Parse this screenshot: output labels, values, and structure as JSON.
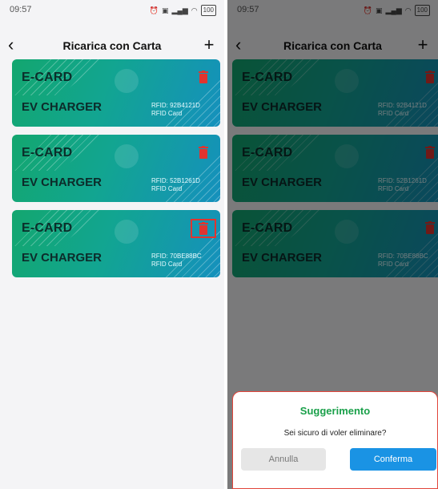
{
  "left_screen": {
    "status": {
      "time": "09:57",
      "icons": [
        "alarm-icon",
        "data-speed-icon",
        "sim-icon",
        "4g-signal-icon",
        "wifi-icon"
      ],
      "battery": "100"
    },
    "nav": {
      "title": "Ricarica con Carta",
      "back_icon": "chevron-left-icon",
      "add_icon": "plus-icon"
    },
    "cards": [
      {
        "brand": "E-CARD",
        "title": "EV CHARGER",
        "rfid": "RFID: 92B4121D",
        "type": "RFID Card"
      },
      {
        "brand": "E-CARD",
        "title": "EV CHARGER",
        "rfid": "RFID: 52B1261D",
        "type": "RFID Card"
      },
      {
        "brand": "E-CARD",
        "title": "EV CHARGER",
        "rfid": "RFID: 70BE88BC",
        "type": "RFID Card"
      }
    ]
  },
  "right_screen": {
    "status": {
      "time": "09:57",
      "battery": "100"
    },
    "nav": {
      "title": "Ricarica con Carta"
    },
    "cards": [
      {
        "brand": "E-CARD",
        "title": "EV CHARGER",
        "rfid": "RFID: 92B4121D",
        "type": "RFID Card"
      },
      {
        "brand": "E-CARD",
        "title": "EV CHARGER",
        "rfid": "RFID: 52B1261D",
        "type": "RFID Card"
      },
      {
        "brand": "E-CARD",
        "title": "EV CHARGER",
        "rfid": "RFID: 70BE88BC",
        "type": "RFID Card"
      }
    ],
    "dialog": {
      "title": "Suggerimento",
      "message": "Sei sicuro di voler eliminare?",
      "cancel_label": "Annulla",
      "confirm_label": "Conferma"
    }
  },
  "colors": {
    "card_gradient_start": "#13a66f",
    "card_gradient_end": "#1590bd",
    "delete_icon": "#e0342f",
    "dialog_title": "#1aa04a",
    "confirm_button": "#1a93e4",
    "highlight_border": "#e0342f"
  }
}
